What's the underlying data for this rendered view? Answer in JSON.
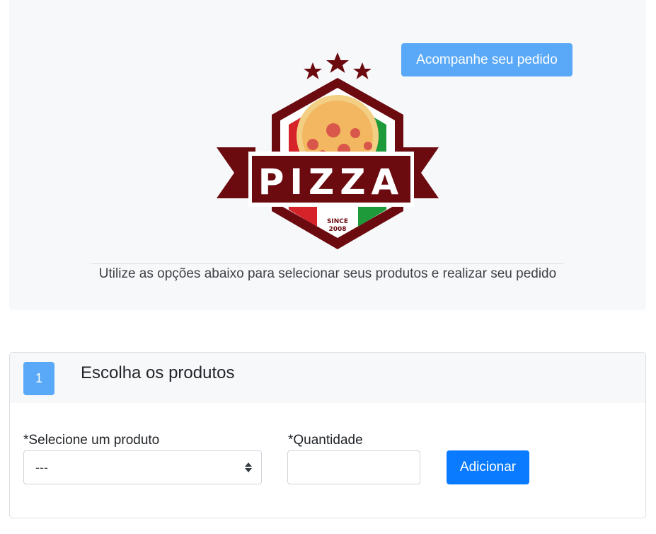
{
  "header": {
    "track_order_label": "Acompanhe seu pedido",
    "logo": {
      "text": "PIZZA",
      "since_line1": "SINCE",
      "since_line2": "2008",
      "colors": {
        "maroon": "#6b0a0f",
        "red": "#d6232a",
        "green": "#1f9a3a"
      }
    },
    "subtitle": "Utilize as opções abaixo para selecionar seus produtos e realizar seu pedido"
  },
  "step1": {
    "badge": "1",
    "title": "Escolha os produtos",
    "product_label": "*Selecione um produto",
    "product_selected": "---",
    "quantity_label": "*Quantidade",
    "quantity_value": "",
    "add_label": "Adicionar"
  },
  "colors": {
    "accent_light": "#5aa9f8",
    "accent": "#0a7bff",
    "panel_bg": "#f7f8fa"
  }
}
